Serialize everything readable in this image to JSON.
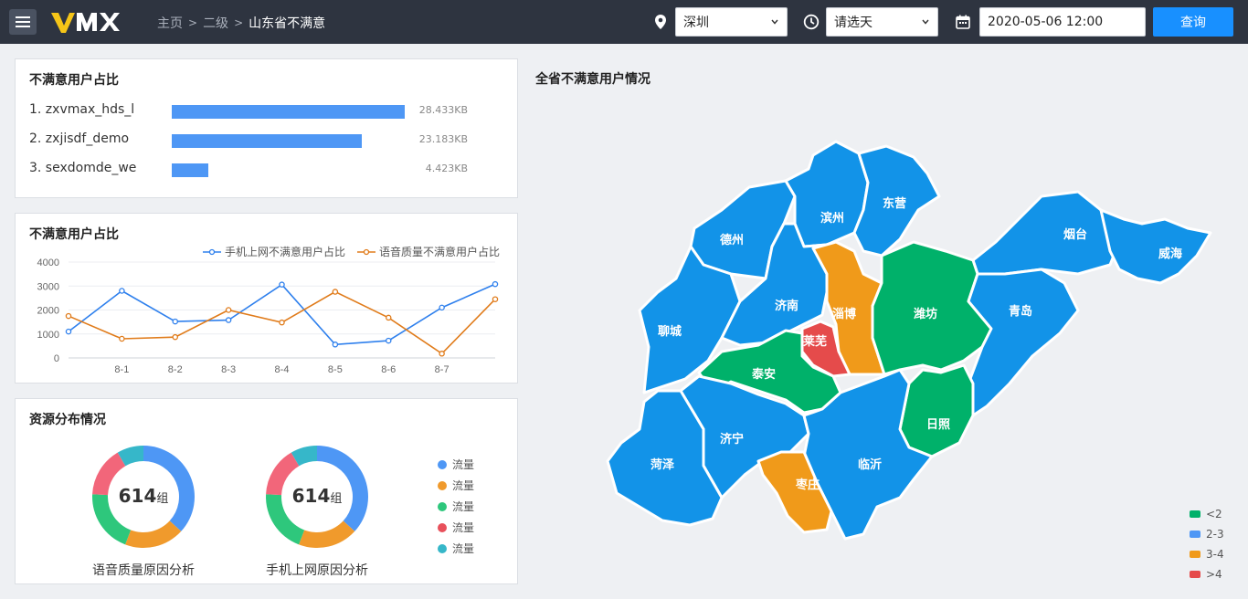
{
  "header": {
    "logo_text": "VMX",
    "breadcrumb": [
      "主页",
      "二级",
      "山东省不满意"
    ],
    "city_select": "深圳",
    "day_select": "请选天",
    "datetime": "2020-05-06 12:00",
    "query_label": "查询",
    "icons": [
      "menu-icon",
      "location-icon",
      "clock-icon",
      "calendar-icon",
      "chevron-down-icon"
    ]
  },
  "ranking": {
    "title": "不满意用户占比",
    "items": [
      {
        "label": "1. zxvmax_hds_l",
        "value_text": "28.433KB",
        "value": 28.433
      },
      {
        "label": "2. zxjisdf_demo",
        "value_text": "23.183KB",
        "value": 23.183
      },
      {
        "label": "3. sexdomde_we",
        "value_text": "4.423KB",
        "value": 4.423
      }
    ]
  },
  "line_panel": {
    "title": "不满意用户占比"
  },
  "chart_data": [
    {
      "type": "line",
      "title": "",
      "x": [
        "8-1",
        "8-2",
        "8-3",
        "8-4",
        "8-5",
        "8-6",
        "8-7"
      ],
      "ylim": [
        0,
        4000
      ],
      "yticks": [
        0,
        1000,
        2000,
        3000,
        4000
      ],
      "legend": "top-right",
      "series": [
        {
          "name": "手机上网不满意用户占比",
          "color": "#2f80ed",
          "values": [
            1100,
            2800,
            1520,
            1580,
            3060,
            560,
            720,
            2100,
            3080
          ]
        },
        {
          "name": "语音质量不满意用户占比",
          "color": "#e07b1a",
          "values": [
            1750,
            800,
            870,
            2000,
            1480,
            2760,
            1680,
            180,
            2450
          ]
        }
      ]
    },
    {
      "type": "pie",
      "title": "语音质量原因分析",
      "center_value": "614",
      "center_unit": "组",
      "series": [
        {
          "name": "流量",
          "value": 35,
          "color": "#4e97f5"
        },
        {
          "name": "流量",
          "value": 18,
          "color": "#f09a2c"
        },
        {
          "name": "流量",
          "value": 19,
          "color": "#2ec77c"
        },
        {
          "name": "流量",
          "value": 15,
          "color": "#f2667a"
        },
        {
          "name": "流量",
          "value": 8,
          "color": "#36b7c9"
        }
      ]
    },
    {
      "type": "pie",
      "title": "手机上网原因分析",
      "center_value": "614",
      "center_unit": "组",
      "series": [
        {
          "name": "流量",
          "value": 35,
          "color": "#4e97f5"
        },
        {
          "name": "流量",
          "value": 18,
          "color": "#f09a2c"
        },
        {
          "name": "流量",
          "value": 19,
          "color": "#2ec77c"
        },
        {
          "name": "流量",
          "value": 15,
          "color": "#f2667a"
        },
        {
          "name": "流量",
          "value": 8,
          "color": "#36b7c9"
        }
      ]
    }
  ],
  "resource_panel": {
    "title": "资源分布情况",
    "legend": [
      {
        "label": "流量",
        "color": "#4e97f5"
      },
      {
        "label": "流量",
        "color": "#f09a2c"
      },
      {
        "label": "流量",
        "color": "#2ec77c"
      },
      {
        "label": "流量",
        "color": "#e8505b"
      },
      {
        "label": "流量",
        "color": "#36b7c9"
      }
    ]
  },
  "map": {
    "title": "全省不满意用户情况",
    "colors": {
      "low": "#00b16a",
      "mid": "#1293e8",
      "high": "#f09a1a",
      "max": "#e54b4b"
    },
    "regions": [
      {
        "name": "德州",
        "level": "2-3"
      },
      {
        "name": "滨州",
        "level": "2-3"
      },
      {
        "name": "东营",
        "level": "2-3"
      },
      {
        "name": "烟台",
        "level": "2-3"
      },
      {
        "name": "威海",
        "level": "2-3"
      },
      {
        "name": "聊城",
        "level": "2-3"
      },
      {
        "name": "济南",
        "level": "2-3"
      },
      {
        "name": "淄博",
        "level": "3-4"
      },
      {
        "name": "潍坊",
        "level": "<2"
      },
      {
        "name": "青岛",
        "level": "2-3"
      },
      {
        "name": "莱芜",
        "level": ">4"
      },
      {
        "name": "泰安",
        "level": "<2"
      },
      {
        "name": "日照",
        "level": "<2"
      },
      {
        "name": "济宁",
        "level": "2-3"
      },
      {
        "name": "菏泽",
        "level": "2-3"
      },
      {
        "name": "临沂",
        "level": "2-3"
      },
      {
        "name": "枣庄",
        "level": "3-4"
      }
    ],
    "legend": [
      {
        "label": "<2",
        "color": "#00b16a"
      },
      {
        "label": "2-3",
        "color": "#4e97f5"
      },
      {
        "label": "3-4",
        "color": "#f09a1a"
      },
      {
        "label": ">4",
        "color": "#e54b4b"
      }
    ]
  }
}
